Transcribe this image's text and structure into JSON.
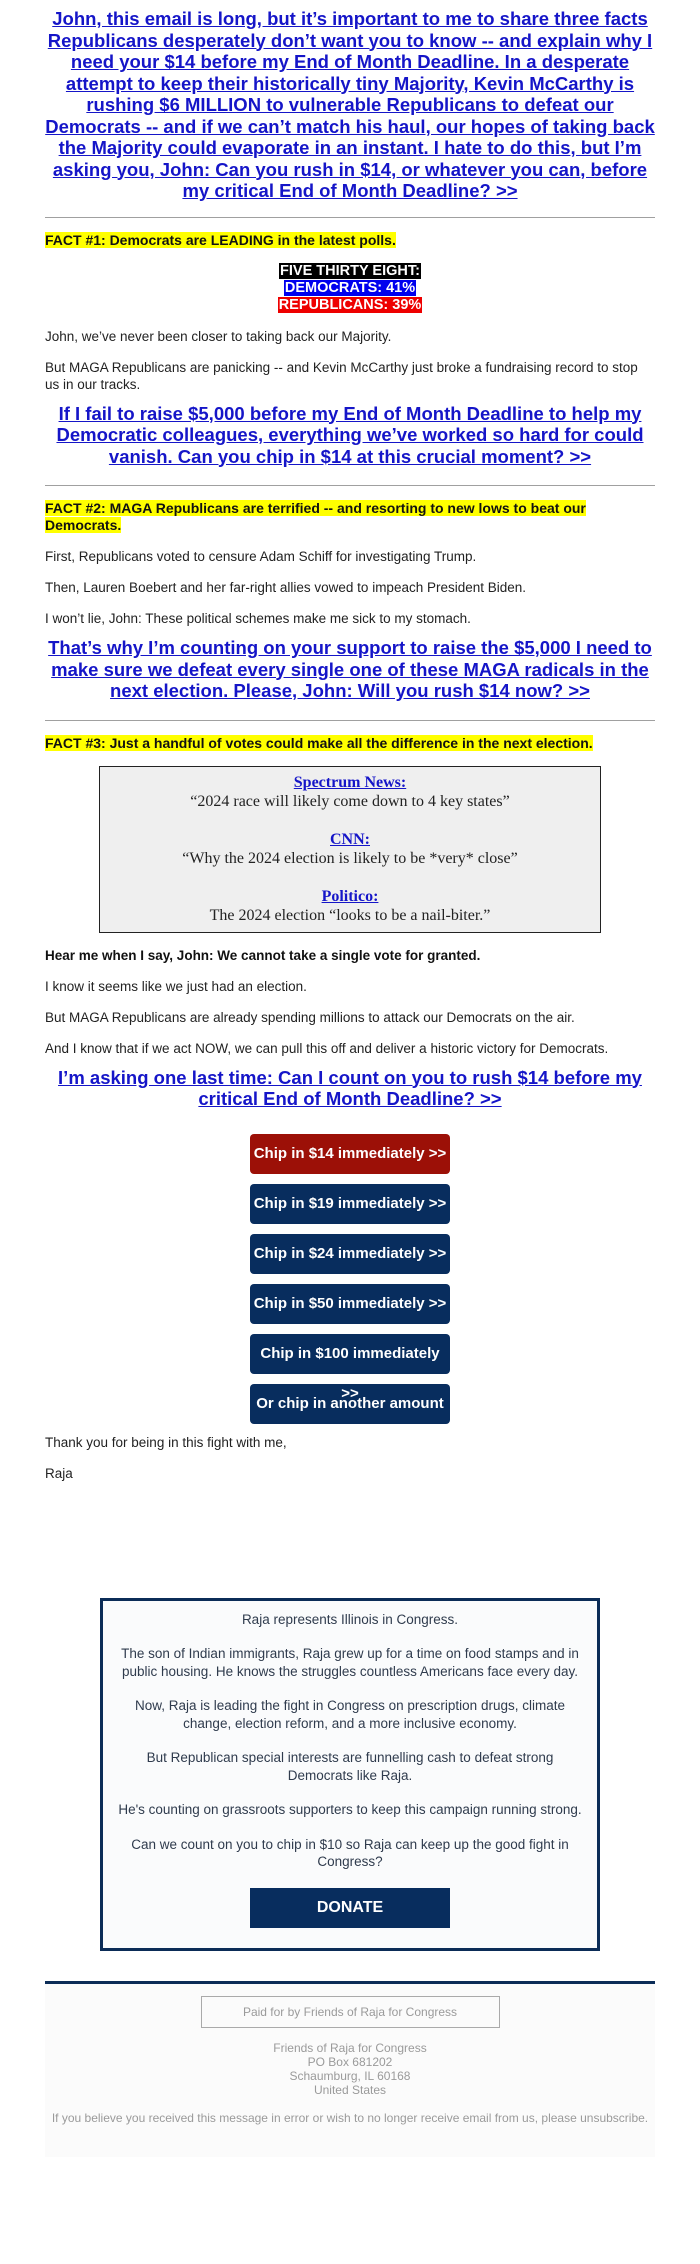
{
  "headline": "John, this email is long, but it’s important to me to share three facts Republicans desperately don’t want you to know -- and explain why I need your $14 before my End of Month Deadline. In a desperate attempt to keep their historically tiny Majority, Kevin McCarthy is rushing $6 MILLION to vulnerable Republicans to defeat our Democrats -- and if we can’t match his haul, our hopes of taking back the Majority could evaporate in an instant. I hate to do this, but I’m asking you, John: Can you rush in $14, or whatever you can, before my critical End of Month Deadline? >>",
  "fact1": {
    "heading": "FACT #1: Democrats are LEADING in the latest polls.",
    "poll": {
      "title": "FIVE THIRTY EIGHT:",
      "democrats": "DEMOCRATS: 41%",
      "republicans": "REPUBLICANS: 39%"
    },
    "paragraphs": [
      "John, we’ve never been closer to taking back our Majority.",
      "But MAGA Republicans are panicking -- and Kevin McCarthy just broke a fundraising record to stop us in our tracks."
    ],
    "cta": "If I fail to raise $5,000 before my End of Month Deadline to help my Democratic colleagues, everything we’ve worked so hard for could vanish. Can you chip in $14 at this crucial moment? >>"
  },
  "fact2": {
    "heading": "FACT #2: MAGA Republicans are terrified -- and resorting to new lows to beat our Democrats.",
    "paragraphs": [
      "First, Republicans voted to censure Adam Schiff for investigating Trump.",
      "Then, Lauren Boebert and her far-right allies vowed to impeach President Biden.",
      "I won’t lie, John: These political schemes make me sick to my stomach."
    ],
    "cta": "That’s why I’m counting on your support to raise the $5,000 I need to make sure we defeat every single one of these MAGA radicals in the next election. Please, John: Will you rush $14 now? >>"
  },
  "fact3": {
    "heading": "FACT #3: Just a handful of votes could make all the difference in the next election.",
    "quotes": [
      {
        "source": "Spectrum News:",
        "text": "“2024 race will likely come down to 4 key states”"
      },
      {
        "source": "CNN:",
        "text": "“Why the 2024 election is likely to be *very* close”"
      },
      {
        "source": "Politico:",
        "text": "The 2024 election “looks to be a nail-biter.”"
      }
    ],
    "bold_paragraph": "Hear me when I say, John: We cannot take a single vote for granted.",
    "paragraphs": [
      "I know it seems like we just had an election.",
      "But MAGA Republicans are already spending millions to attack our Democrats on the air.",
      "And I know that if we act NOW, we can pull this off and deliver a historic victory for Democrats."
    ],
    "cta": "I’m asking one last time: Can I count on you to rush $14 before my critical End of Month Deadline? >>"
  },
  "buttons": [
    {
      "label": "Chip in $14 immediately >>",
      "color": "#9c1007"
    },
    {
      "label": "Chip in $19 immediately >>",
      "color": "#082d5e"
    },
    {
      "label": "Chip in $24 immediately >>",
      "color": "#082d5e"
    },
    {
      "label": "Chip in $50 immediately >>",
      "color": "#082d5e"
    },
    {
      "label": "Chip in $100 immediately >>",
      "color": "#082d5e"
    },
    {
      "label": "Or chip in another amount >>",
      "color": "#082d5e"
    }
  ],
  "signoff": {
    "closing": "Thank you for being in this fight with me,",
    "name": "Raja"
  },
  "bio": {
    "paragraphs": [
      "Raja represents Illinois in Congress.",
      "The son of Indian immigrants, Raja grew up for a time on food stamps and in public housing. He knows the struggles countless Americans face every day.",
      "Now, Raja is leading the fight in Congress on prescription drugs, climate change, election reform, and a more inclusive economy.",
      "But Republican special interests are funnelling cash to defeat strong Democrats like Raja.",
      "He's counting on grassroots supporters to keep this campaign running strong.",
      "Can we count on you to chip in $10 so Raja can keep up the good fight in Congress?"
    ],
    "donate_label": "DONATE"
  },
  "footer": {
    "paid_for": "Paid for by Friends of Raja for Congress",
    "address": [
      "Friends of Raja for Congress",
      "PO Box 681202",
      "Schaumburg, IL 60168",
      "United States"
    ],
    "unsubscribe": "If you believe you received this message in error or wish to no longer receive email from us, please unsubscribe."
  },
  "colors": {
    "link": "#1515c8",
    "highlight": "#ffff00",
    "navy": "#082d5e",
    "red_button": "#9c1007",
    "dem_blue": "#0000ee",
    "rep_red": "#ee0000"
  }
}
